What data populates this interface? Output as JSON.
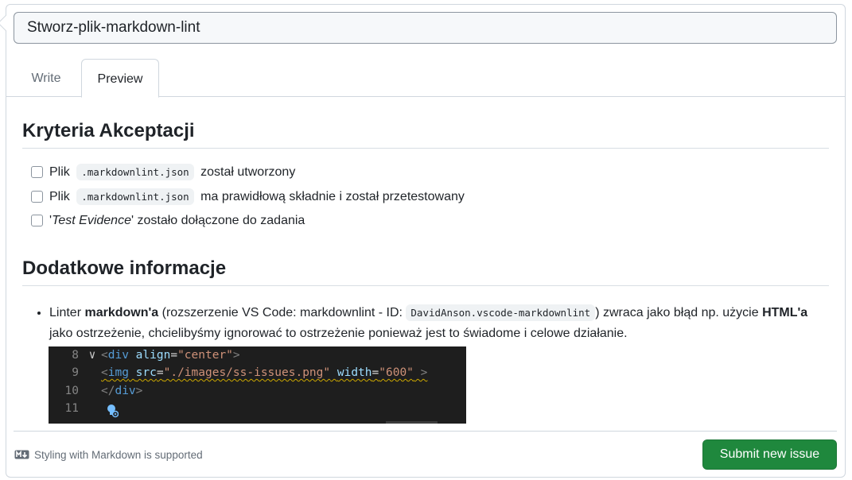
{
  "issue": {
    "title_value": "Stworz-plik-markdown-lint"
  },
  "tabs": [
    {
      "label": "Write",
      "active": false
    },
    {
      "label": "Preview",
      "active": true
    }
  ],
  "preview": {
    "heading1": "Kryteria Akceptacji",
    "tasks": [
      {
        "before": "Plik",
        "code": ".markdownlint.json",
        "after": "został utworzony",
        "checked": false
      },
      {
        "before": "Plik",
        "code": ".markdownlint.json",
        "after": "ma prawidłową składnie i został przetestowany",
        "checked": false
      },
      {
        "quote_open": "'",
        "emphasis": "Test Evidence",
        "quote_close": "'",
        "after": " zostało dołączone do zadania",
        "checked": false
      }
    ],
    "heading2": "Dodatkowe informacje",
    "bullet": {
      "t1": "Linter ",
      "b1": "markdown'a",
      "t2": " (rozszerzenie VS Code: markdownlint - ID: ",
      "code": "DavidAnson.vscode-markdownlint",
      "t3": ") zwraca jako błąd np. użycie ",
      "b2": "HTML'a",
      "t4": " jako ostrzeżenie, chcielibyśmy ignorować to ostrzeżenie ponieważ jest to świadome i celowe działanie."
    },
    "code_image": {
      "lines": [
        {
          "num": "8",
          "fold": "∨"
        },
        {
          "num": "9",
          "fold": ""
        },
        {
          "num": "10",
          "fold": ""
        },
        {
          "num": "11",
          "fold": ""
        }
      ],
      "l8": {
        "open": "<",
        "tag": "div",
        "sp": " ",
        "attr": "align",
        "eq": "=",
        "val": "\"center\"",
        "close": ">"
      },
      "l9": {
        "open": "<",
        "tag": "img",
        "sp1": " ",
        "attr1": "src",
        "eq1": "=",
        "val1": "\"./images/ss-issues.png\"",
        "sp2": " ",
        "attr2": "width",
        "eq2": "=",
        "val2": "\"600\"",
        "close": " >"
      },
      "l10": {
        "open": "</",
        "tag": "div",
        "close": ">"
      },
      "colors": {
        "background": "#1e1e1e",
        "tag": "#569cd6",
        "attr": "#9cdcfe",
        "string": "#ce9178",
        "warning": "#cca700"
      }
    }
  },
  "footer": {
    "markdown_note": "Styling with Markdown is supported",
    "markdown_icon": "markdown-icon",
    "submit_label": "Submit new issue"
  },
  "colors": {
    "submit_bg": "#1f883d",
    "border": "#d0d7de",
    "muted_text": "#636c76"
  }
}
